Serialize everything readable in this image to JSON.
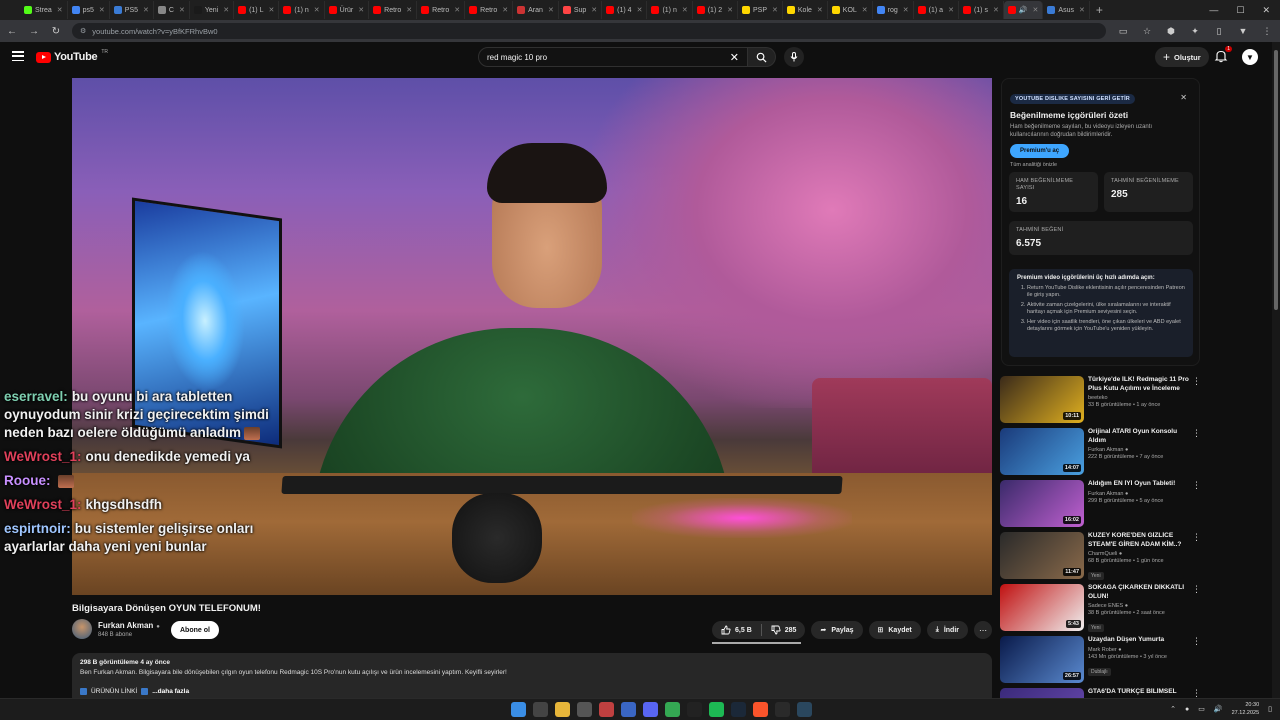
{
  "browser": {
    "tabs": [
      {
        "label": "Strea",
        "color": "#53fc18"
      },
      {
        "label": "ps5 ",
        "color": "#4285f4"
      },
      {
        "label": "PS5 ",
        "color": "#3a7bd5"
      },
      {
        "label": "C",
        "color": "#888888"
      },
      {
        "label": "Yeni ",
        "color": "#1a1a1a"
      },
      {
        "label": "(1) L",
        "color": "#ff0000"
      },
      {
        "label": "(1) n",
        "color": "#ff0000"
      },
      {
        "label": "Ürür",
        "color": "#ff0000"
      },
      {
        "label": "Retro",
        "color": "#ff0000"
      },
      {
        "label": "Retro",
        "color": "#ff0000"
      },
      {
        "label": "Retro",
        "color": "#ff0000"
      },
      {
        "label": "Aran",
        "color": "#cc3333"
      },
      {
        "label": "Sup",
        "color": "#ff4444"
      },
      {
        "label": "(1) 4",
        "color": "#ff0000"
      },
      {
        "label": "(1) n",
        "color": "#ff0000"
      },
      {
        "label": "(1) 2",
        "color": "#ff0000"
      },
      {
        "label": "PSP",
        "color": "#ffd700"
      },
      {
        "label": "Kole",
        "color": "#ffd700"
      },
      {
        "label": "KOL",
        "color": "#ffd700"
      },
      {
        "label": "rog",
        "color": "#4285f4"
      },
      {
        "label": "(1) a",
        "color": "#ff0000"
      },
      {
        "label": "(1) s",
        "color": "#ff0000"
      },
      {
        "label": "🔊",
        "color": "#ff0000",
        "active": true
      },
      {
        "label": "Asus",
        "color": "#3a7bd5"
      }
    ],
    "url": "youtube.com/watch?v=yBfKFRhvBw0"
  },
  "masthead": {
    "logo": "YouTube",
    "region": "TR",
    "search_value": "red magic 10 pro",
    "create_label": "Oluştur",
    "notif_count": "1",
    "avatar_letter": "▼"
  },
  "chat": [
    {
      "name": "eserravel:",
      "text": "bu oyunu bi ara tabletten oynuyodum sinir krizi geçirecektim şimdi neden bazı oelere öldüğümü anladım",
      "color": "#7ecfb0",
      "emote": true
    },
    {
      "name": "WeWrost_1:",
      "text": "onu denedikde yemedi ya",
      "color": "#e0405a",
      "emote": false
    },
    {
      "name": "Rooue:",
      "text": "",
      "color": "#c890ff",
      "emote": true
    },
    {
      "name": "WeWrost_1:",
      "text": "khgsdhsdfh",
      "color": "#e0405a",
      "emote": false
    },
    {
      "name": "espirtnoir:",
      "text": "bu sistemler gelişirse onları ayarlarlar daha yeni yeni bunlar",
      "color": "#9fc6ff",
      "emote": false
    }
  ],
  "video": {
    "title": "Bilgisayara Dönüşen OYUN TELEFONUM!",
    "channel": "Furkan Akman",
    "subscribers": "848 B abone",
    "subscribe_label": "Abone ol",
    "likes": "6,5 B",
    "dislikes": "285",
    "like_fraction": 0.958,
    "share_label": "Paylaş",
    "save_label": "Kaydet",
    "download_label": "İndir",
    "views_line": "298 B görüntüleme  4 ay önce",
    "description": "Ben Furkan Akman. Bilgisayara bile dönüşebilen çılgın oyun telefonu Redmagic 10S Pro'nun kutu açılışı ve ürün incelemesini yaptım. Keyifli seyirler!",
    "desc_link": "ÜRÜNÜN LİNKİ",
    "more_label": "...daha fazla"
  },
  "panel": {
    "badge": "YOUTUBE DISLIKE SAYISINI GERİ GETİR",
    "title": "Beğenilmeme içgörüleri özeti",
    "subtitle": "Ham beğenilmeme sayıları, bu videoyu izleyen uzantı kullanıcılarının doğrudan bildirimleridir.",
    "premium_btn": "Premium'u aç",
    "preview_link": "Tüm analitiği önizle",
    "raw_label": "HAM BEĞENİLMEME SAYISI",
    "raw_value": "16",
    "est_dislike_label": "TAHMİNİ BEĞENİLMEME",
    "est_dislike_value": "285",
    "est_like_label": "TAHMİNİ BEĞENİ",
    "est_like_value": "6.575",
    "steps_title": "Premium video içgörülerini üç hızlı adımda açın:",
    "steps": [
      "Return YouTube Dislike eklentisinin açılır penceresinden Patreon ile giriş yapın.",
      "Aktivite zaman çizelgelerini, ülke sıralamalarını ve interaktif haritayı açmak için Premium seviyesini seçin.",
      "Her video için saatlik trendleri, öne çıkan ülkeleri ve ABD eyalet detaylarını görmek için YouTube'u yeniden yükleyin."
    ]
  },
  "related": [
    {
      "title": "Türkiye'de İLK! Redmagic 11 Pro Plus Kutu Açılımı ve İnceleme",
      "channel": "beeteko",
      "meta": "33 B görüntüleme • 1 ay önce",
      "duration": "10:11",
      "tag": "",
      "verified": false,
      "c1": "#3a2a1a",
      "c2": "#e0b020"
    },
    {
      "title": "Orijinal ATARİ Oyun Konsolu Aldım",
      "channel": "Furkan Akman",
      "meta": "222 B görüntüleme • 7 ay önce",
      "duration": "14:07",
      "tag": "",
      "verified": true,
      "c1": "#1a3a7a",
      "c2": "#4aa0e0"
    },
    {
      "title": "Aldığım EN İYİ Oyun Tableti!",
      "channel": "Furkan Akman",
      "meta": "299 B görüntüleme • 5 ay önce",
      "duration": "16:02",
      "tag": "",
      "verified": true,
      "c1": "#3a2a6a",
      "c2": "#c060d0"
    },
    {
      "title": "KUZEY KORE'DEN GİZLİCE STEAM'E GİREN ADAM KİM..?",
      "channel": "CharmQueli",
      "meta": "68 B görüntüleme • 1 gün önce",
      "duration": "11:47",
      "tag": "Yeni",
      "verified": true,
      "c1": "#2a2a2a",
      "c2": "#8a6a4a"
    },
    {
      "title": "SOKAĞA ÇIKARKEN DİKKATLİ OLUN!",
      "channel": "Sadece ENES",
      "meta": "38 B görüntüleme • 2 saat önce",
      "duration": "5:43",
      "tag": "Yeni",
      "verified": true,
      "c1": "#c01010",
      "c2": "#f0f0f0"
    },
    {
      "title": "Uzaydan Düşen Yumurta",
      "channel": "Mark Rober",
      "meta": "143 Mn görüntüleme • 3 yıl önce",
      "duration": "26:57",
      "tag": "Dublajlı",
      "verified": true,
      "c1": "#0a1a4a",
      "c2": "#5a8ad0"
    },
    {
      "title": "GTA6'DA TÜRKÇE BİLİMSEL",
      "channel": "",
      "meta": "",
      "duration": "",
      "tag": "",
      "verified": false,
      "c1": "#3a2a7a",
      "c2": "#6a4ab0"
    }
  ],
  "taskbar": {
    "icons": [
      {
        "name": "windows-start-icon",
        "color": "#3a8ee6"
      },
      {
        "name": "search-icon",
        "color": "#444444"
      },
      {
        "name": "file-explorer-icon",
        "color": "#e6b53a"
      },
      {
        "name": "calculator-icon",
        "color": "#555555"
      },
      {
        "name": "calendar-icon",
        "color": "#c04040"
      },
      {
        "name": "app-icon",
        "color": "#3a66c4"
      },
      {
        "name": "discord-icon",
        "color": "#5865f2"
      },
      {
        "name": "chrome-icon",
        "color": "#34a853"
      },
      {
        "name": "obs-icon",
        "color": "#222222"
      },
      {
        "name": "spotify-icon",
        "color": "#1db954"
      },
      {
        "name": "steam-icon",
        "color": "#1b2838"
      },
      {
        "name": "brave-icon",
        "color": "#fb542b"
      },
      {
        "name": "epic-games-icon",
        "color": "#2a2a2a"
      },
      {
        "name": "steam-client-icon",
        "color": "#2a475e"
      }
    ],
    "time": "20:30",
    "date": "27.12.2025"
  }
}
